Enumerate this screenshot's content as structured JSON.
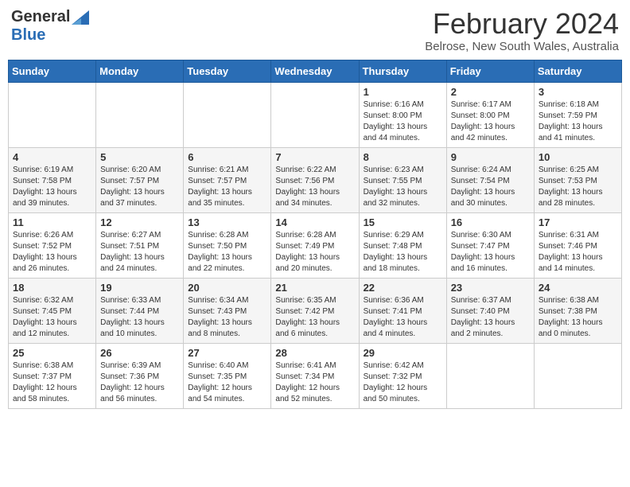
{
  "header": {
    "logo_general": "General",
    "logo_blue": "Blue",
    "title": "February 2024",
    "subtitle": "Belrose, New South Wales, Australia"
  },
  "days_of_week": [
    "Sunday",
    "Monday",
    "Tuesday",
    "Wednesday",
    "Thursday",
    "Friday",
    "Saturday"
  ],
  "weeks": [
    [
      {
        "day": "",
        "info": ""
      },
      {
        "day": "",
        "info": ""
      },
      {
        "day": "",
        "info": ""
      },
      {
        "day": "",
        "info": ""
      },
      {
        "day": "1",
        "info": "Sunrise: 6:16 AM\nSunset: 8:00 PM\nDaylight: 13 hours\nand 44 minutes."
      },
      {
        "day": "2",
        "info": "Sunrise: 6:17 AM\nSunset: 8:00 PM\nDaylight: 13 hours\nand 42 minutes."
      },
      {
        "day": "3",
        "info": "Sunrise: 6:18 AM\nSunset: 7:59 PM\nDaylight: 13 hours\nand 41 minutes."
      }
    ],
    [
      {
        "day": "4",
        "info": "Sunrise: 6:19 AM\nSunset: 7:58 PM\nDaylight: 13 hours\nand 39 minutes."
      },
      {
        "day": "5",
        "info": "Sunrise: 6:20 AM\nSunset: 7:57 PM\nDaylight: 13 hours\nand 37 minutes."
      },
      {
        "day": "6",
        "info": "Sunrise: 6:21 AM\nSunset: 7:57 PM\nDaylight: 13 hours\nand 35 minutes."
      },
      {
        "day": "7",
        "info": "Sunrise: 6:22 AM\nSunset: 7:56 PM\nDaylight: 13 hours\nand 34 minutes."
      },
      {
        "day": "8",
        "info": "Sunrise: 6:23 AM\nSunset: 7:55 PM\nDaylight: 13 hours\nand 32 minutes."
      },
      {
        "day": "9",
        "info": "Sunrise: 6:24 AM\nSunset: 7:54 PM\nDaylight: 13 hours\nand 30 minutes."
      },
      {
        "day": "10",
        "info": "Sunrise: 6:25 AM\nSunset: 7:53 PM\nDaylight: 13 hours\nand 28 minutes."
      }
    ],
    [
      {
        "day": "11",
        "info": "Sunrise: 6:26 AM\nSunset: 7:52 PM\nDaylight: 13 hours\nand 26 minutes."
      },
      {
        "day": "12",
        "info": "Sunrise: 6:27 AM\nSunset: 7:51 PM\nDaylight: 13 hours\nand 24 minutes."
      },
      {
        "day": "13",
        "info": "Sunrise: 6:28 AM\nSunset: 7:50 PM\nDaylight: 13 hours\nand 22 minutes."
      },
      {
        "day": "14",
        "info": "Sunrise: 6:28 AM\nSunset: 7:49 PM\nDaylight: 13 hours\nand 20 minutes."
      },
      {
        "day": "15",
        "info": "Sunrise: 6:29 AM\nSunset: 7:48 PM\nDaylight: 13 hours\nand 18 minutes."
      },
      {
        "day": "16",
        "info": "Sunrise: 6:30 AM\nSunset: 7:47 PM\nDaylight: 13 hours\nand 16 minutes."
      },
      {
        "day": "17",
        "info": "Sunrise: 6:31 AM\nSunset: 7:46 PM\nDaylight: 13 hours\nand 14 minutes."
      }
    ],
    [
      {
        "day": "18",
        "info": "Sunrise: 6:32 AM\nSunset: 7:45 PM\nDaylight: 13 hours\nand 12 minutes."
      },
      {
        "day": "19",
        "info": "Sunrise: 6:33 AM\nSunset: 7:44 PM\nDaylight: 13 hours\nand 10 minutes."
      },
      {
        "day": "20",
        "info": "Sunrise: 6:34 AM\nSunset: 7:43 PM\nDaylight: 13 hours\nand 8 minutes."
      },
      {
        "day": "21",
        "info": "Sunrise: 6:35 AM\nSunset: 7:42 PM\nDaylight: 13 hours\nand 6 minutes."
      },
      {
        "day": "22",
        "info": "Sunrise: 6:36 AM\nSunset: 7:41 PM\nDaylight: 13 hours\nand 4 minutes."
      },
      {
        "day": "23",
        "info": "Sunrise: 6:37 AM\nSunset: 7:40 PM\nDaylight: 13 hours\nand 2 minutes."
      },
      {
        "day": "24",
        "info": "Sunrise: 6:38 AM\nSunset: 7:38 PM\nDaylight: 13 hours\nand 0 minutes."
      }
    ],
    [
      {
        "day": "25",
        "info": "Sunrise: 6:38 AM\nSunset: 7:37 PM\nDaylight: 12 hours\nand 58 minutes."
      },
      {
        "day": "26",
        "info": "Sunrise: 6:39 AM\nSunset: 7:36 PM\nDaylight: 12 hours\nand 56 minutes."
      },
      {
        "day": "27",
        "info": "Sunrise: 6:40 AM\nSunset: 7:35 PM\nDaylight: 12 hours\nand 54 minutes."
      },
      {
        "day": "28",
        "info": "Sunrise: 6:41 AM\nSunset: 7:34 PM\nDaylight: 12 hours\nand 52 minutes."
      },
      {
        "day": "29",
        "info": "Sunrise: 6:42 AM\nSunset: 7:32 PM\nDaylight: 12 hours\nand 50 minutes."
      },
      {
        "day": "",
        "info": ""
      },
      {
        "day": "",
        "info": ""
      }
    ]
  ]
}
